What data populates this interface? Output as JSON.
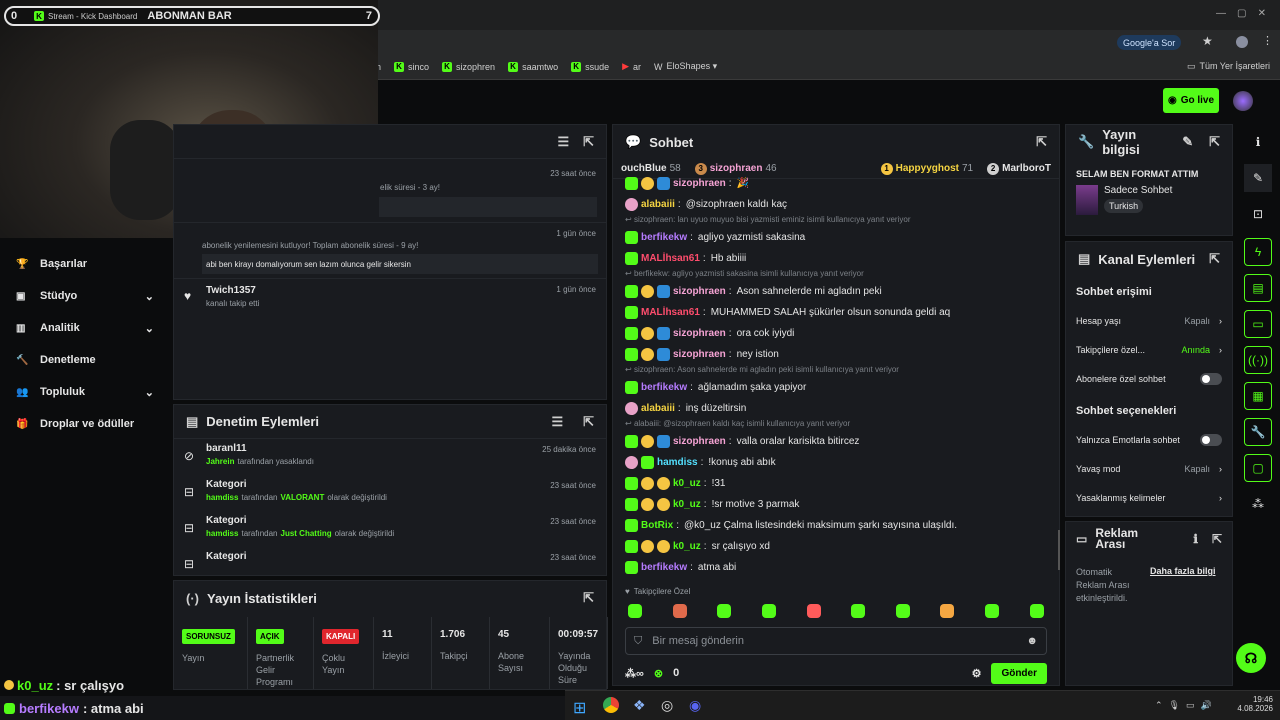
{
  "browser": {
    "tab_title": "Stream - Kick Dashboard",
    "search_btn": "Google'a Sor",
    "bookmarks": [
      "n",
      "sinco",
      "sizophren",
      "saamtwo",
      "ssude",
      "ar",
      "EloShapes ▾"
    ],
    "all_bookmarks": "Tüm Yer İşaretleri"
  },
  "overlay": {
    "left": "0",
    "title": "ABONMAN BAR",
    "right": "7"
  },
  "header": {
    "go_live": "Go live"
  },
  "sidebar": {
    "items": [
      {
        "label": "Başarılar",
        "icon": "trophy-icon",
        "chev": false
      },
      {
        "label": "Stüdyo",
        "icon": "studio-icon",
        "chev": true
      },
      {
        "label": "Analitik",
        "icon": "analytics-icon",
        "chev": true
      },
      {
        "label": "Denetleme",
        "icon": "hammer-icon",
        "chev": false
      },
      {
        "label": "Topluluk",
        "icon": "community-icon",
        "chev": true
      },
      {
        "label": "Droplar ve ödüller",
        "icon": "drops-icon",
        "chev": false
      }
    ]
  },
  "activity": {
    "items": [
      {
        "text": "elik süresi - 3 ay!",
        "time": "23 saat önce"
      },
      {
        "text": "abonelik yenilemesini kutluyor! Toplam abonelik süresi - 9 ay!",
        "sub": "abi ben kirayı domalıyorum sen lazım olunca gelir sikersin",
        "time": "1 gün önce"
      },
      {
        "name": "Twich1357",
        "text": "kanalı takip etti",
        "time": "1 gün önce"
      }
    ]
  },
  "moderation": {
    "title": "Denetim Eylemleri",
    "items": [
      {
        "name": "baranl11",
        "by": "Jahrein",
        "rest": "tarafından yasaklandı",
        "time": "25 dakika önce"
      },
      {
        "name": "Kategori",
        "by": "hamdiss",
        "mid": "tarafından",
        "val": "VALORANT",
        "rest": "olarak değiştirildi",
        "time": "23 saat önce"
      },
      {
        "name": "Kategori",
        "by": "hamdiss",
        "mid": "tarafından",
        "val": "Just Chatting",
        "rest": "olarak değiştirildi",
        "time": "23 saat önce"
      },
      {
        "name": "Kategori",
        "time": "23 saat önce"
      }
    ]
  },
  "stats": {
    "title": "Yayın İstatistikleri",
    "cells": [
      {
        "badge": "SORUNSUZ",
        "label": "Yayın"
      },
      {
        "badge": "AÇIK",
        "label": "Partnerlik Gelir Programı"
      },
      {
        "badge": "KAPALI",
        "label": "Çoklu Yayın"
      },
      {
        "value": "11",
        "label": "İzleyici"
      },
      {
        "value": "1.706",
        "label": "Takipçi"
      },
      {
        "value": "45",
        "label": "Abone Sayısı"
      },
      {
        "value": "00:09:57",
        "label": "Yayında Olduğu Süre"
      }
    ]
  },
  "chat": {
    "title": "Sohbet",
    "leaders": [
      {
        "name": "ouchBlue",
        "n": "58"
      },
      {
        "name": "sizophraen",
        "n": "46",
        "rank": "3"
      },
      {
        "name": "Happyyghost",
        "n": "71",
        "rank": "1"
      },
      {
        "name": "MarlboroT",
        "rank": "2"
      }
    ],
    "messages": [
      {
        "user": "sizophraen",
        "color": "#f5a3d4",
        "text": "🎉"
      },
      {
        "user": "alabaiii",
        "color": "#f5d442",
        "text": "@sizophraen kaldı kaç"
      },
      {
        "reply": "sizophraen: lan uyuo muyuo bisi yazmisti eminiz isimli kullanıcıya yanıt veriyor"
      },
      {
        "user": "berfikekw",
        "color": "#b67cff",
        "text": "agliyo yazmisti sakasina"
      },
      {
        "user": "MALİhsan61",
        "color": "#ff4d6d",
        "text": "Hb abiiii"
      },
      {
        "reply": "berfikekw: agliyo yazmisti sakasina isimli kullanıcıya yanıt veriyor"
      },
      {
        "user": "sizophraen",
        "color": "#f5a3d4",
        "text": "Ason sahnelerde mi agladın peki"
      },
      {
        "user": "MALİhsan61",
        "color": "#ff4d6d",
        "text": "MUHAMMED SALAH şükürler olsun sonunda geldi aq"
      },
      {
        "user": "sizophraen",
        "color": "#f5a3d4",
        "text": "ora cok iyiydi"
      },
      {
        "user": "sizophraen",
        "color": "#f5a3d4",
        "text": "ney istion"
      },
      {
        "reply": "sizophraen: Ason sahnelerde mi agladın peki isimli kullanıcıya yanıt veriyor"
      },
      {
        "user": "berfikekw",
        "color": "#b67cff",
        "text": "ağlamadım şaka yapiyor"
      },
      {
        "user": "alabaiii",
        "color": "#f5d442",
        "text": "inş düzeltirsin"
      },
      {
        "reply": "alabaiii: @sizophraen kaldı kaç isimli kullanıcıya yanıt veriyor"
      },
      {
        "user": "sizophraen",
        "color": "#f5a3d4",
        "text": "valla oralar karisikta bitircez"
      },
      {
        "user": "hamdiss",
        "color": "#53e0ff",
        "text": "!konuş abi abık"
      },
      {
        "user": "k0_uz",
        "color": "#53fc18",
        "text": "!31"
      },
      {
        "user": "k0_uz",
        "color": "#53fc18",
        "text": "!sr motive 3 parmak"
      },
      {
        "user": "BotRix",
        "color": "#53fc18",
        "text": "@k0_uz Çalma listesindeki maksimum şarkı sayısına ulaşıldı."
      },
      {
        "user": "k0_uz",
        "color": "#53fc18",
        "text": "sr çalışıyo xd"
      },
      {
        "user": "berfikekw",
        "color": "#b67cff",
        "text": "atma abi"
      }
    ],
    "mode": "Takipçilere Özel",
    "placeholder": "Bir mesaj gönderin",
    "points": "0",
    "send": "Gönder"
  },
  "info": {
    "title": "Yayın bilgisi",
    "stream_title": "SELAM BEN FORMAT ATTIM",
    "category": "Sadece Sohbet",
    "lang": "Turkish"
  },
  "channel": {
    "title": "Kanal Eylemleri",
    "sec1": "Sohbet erişimi",
    "r1": "Hesap yaşı",
    "r1v": "Kapalı",
    "r2": "Takipçilere özel...",
    "r2v": "Anında",
    "r3": "Abonelere özel sohbet",
    "sec2": "Sohbet seçenekleri",
    "r4": "Yalnızca Emotlarla sohbet",
    "r5": "Yavaş mod",
    "r5v": "Kapalı",
    "r6": "Yasaklanmış kelimeler"
  },
  "ads": {
    "title": "Reklam Arası",
    "text": "Otomatik Reklam Arası etkinleştirildi.",
    "link": "Daha fazla bilgi"
  },
  "ticker": [
    {
      "user": "k0_uz",
      "text": ": sr çalışyo"
    },
    {
      "user": "berfikekw",
      "text": ": atma abi"
    }
  ],
  "taskbar": {
    "time": "19:46",
    "date": "4.08.2026"
  }
}
